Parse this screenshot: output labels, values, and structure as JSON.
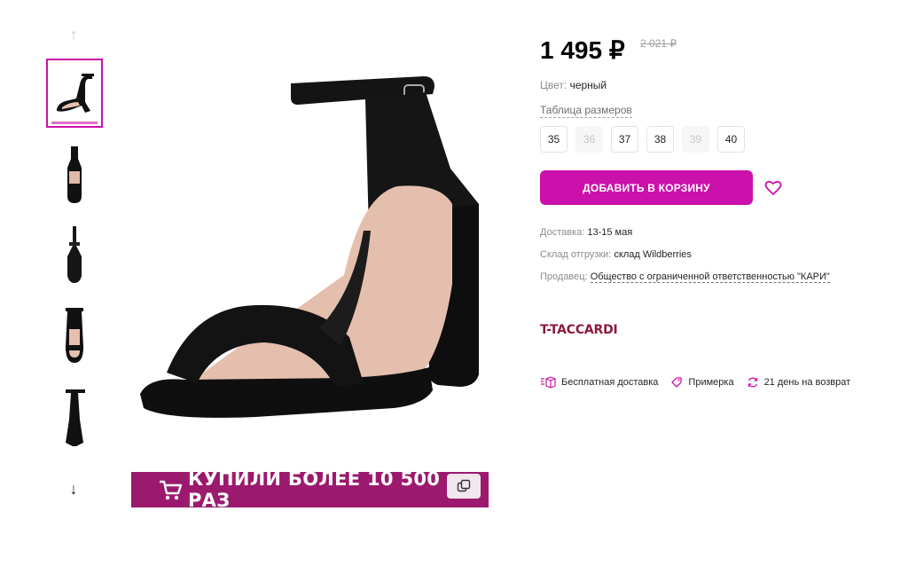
{
  "gallery": {
    "up_arrow": "↑",
    "down_arrow": "↓",
    "thumbnails": [
      "sandal-angle",
      "sandal-side",
      "sandal-back",
      "sandal-front",
      "sandal-rear"
    ],
    "active_index": 0
  },
  "banner": {
    "text": "КУПИЛИ БОЛЕЕ 10 500 РАЗ",
    "cart_icon": "cart-icon",
    "copy_icon": "copy-icon",
    "color": "#9b1a6e"
  },
  "product": {
    "price": "1 495 ₽",
    "old_price": "2 021 ₽",
    "color_label": "Цвет:",
    "color_value": "черный",
    "size_table_label": "Таблица размеров",
    "sizes": [
      {
        "label": "35",
        "available": true
      },
      {
        "label": "36",
        "available": false
      },
      {
        "label": "37",
        "available": true
      },
      {
        "label": "38",
        "available": true
      },
      {
        "label": "39",
        "available": false
      },
      {
        "label": "40",
        "available": true
      }
    ],
    "add_to_cart": "ДОБАВИТЬ В КОРЗИНУ",
    "accent_color": "#cb11ab",
    "delivery_label": "Доставка:",
    "delivery_value": "13-15 мая",
    "warehouse_label": "Склад отгрузки:",
    "warehouse_value": "склад Wildberries",
    "seller_label": "Продавец:",
    "seller_value": "Общество с ограниченной ответственностью \"КАРИ\"",
    "brand": "T-TACCARDI",
    "features": [
      {
        "icon": "box-icon",
        "label": "Бесплатная доставка"
      },
      {
        "icon": "tag-icon",
        "label": "Примерка"
      },
      {
        "icon": "return-icon",
        "label": "21 день на возврат"
      }
    ]
  }
}
